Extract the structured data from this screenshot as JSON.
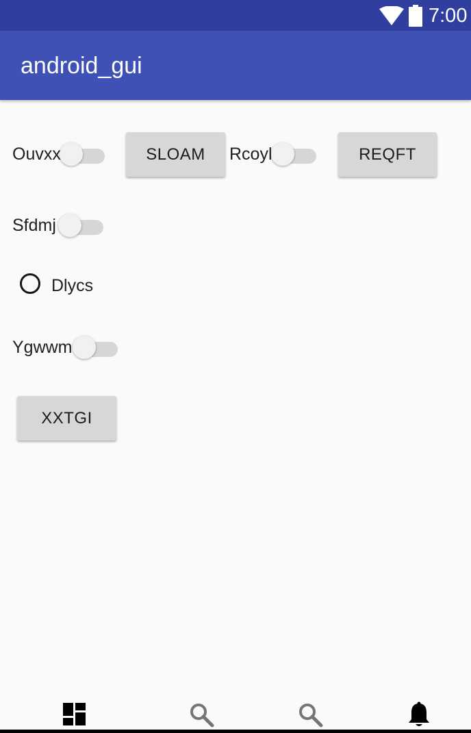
{
  "status_bar": {
    "time": "7:00",
    "icons": [
      "wifi-icon",
      "battery-icon"
    ]
  },
  "app_bar": {
    "title": "android_gui"
  },
  "content": {
    "switch_ouvxx": {
      "label": "Ouvxx",
      "checked": false
    },
    "button_sloam": {
      "label": "SLOAM"
    },
    "switch_rcoyl": {
      "label": "Rcoyl",
      "checked": false
    },
    "button_reqft": {
      "label": "REQFT"
    },
    "switch_sfdmj": {
      "label": "Sfdmj",
      "checked": false
    },
    "radio_dlycs": {
      "label": "Dlycs",
      "checked": false
    },
    "switch_ygwwm": {
      "label": "Ygwwm",
      "checked": false
    },
    "button_xxtgi": {
      "label": "XXTGI"
    }
  },
  "bottom_nav": {
    "items": [
      {
        "icon": "dashboard-icon"
      },
      {
        "icon": "search-icon"
      },
      {
        "icon": "search-icon"
      },
      {
        "icon": "bell-icon"
      }
    ]
  },
  "colors": {
    "status_bar": "#303f9f",
    "app_bar": "#3f51b5",
    "background": "#fafafa",
    "button": "#d7d7d7"
  }
}
